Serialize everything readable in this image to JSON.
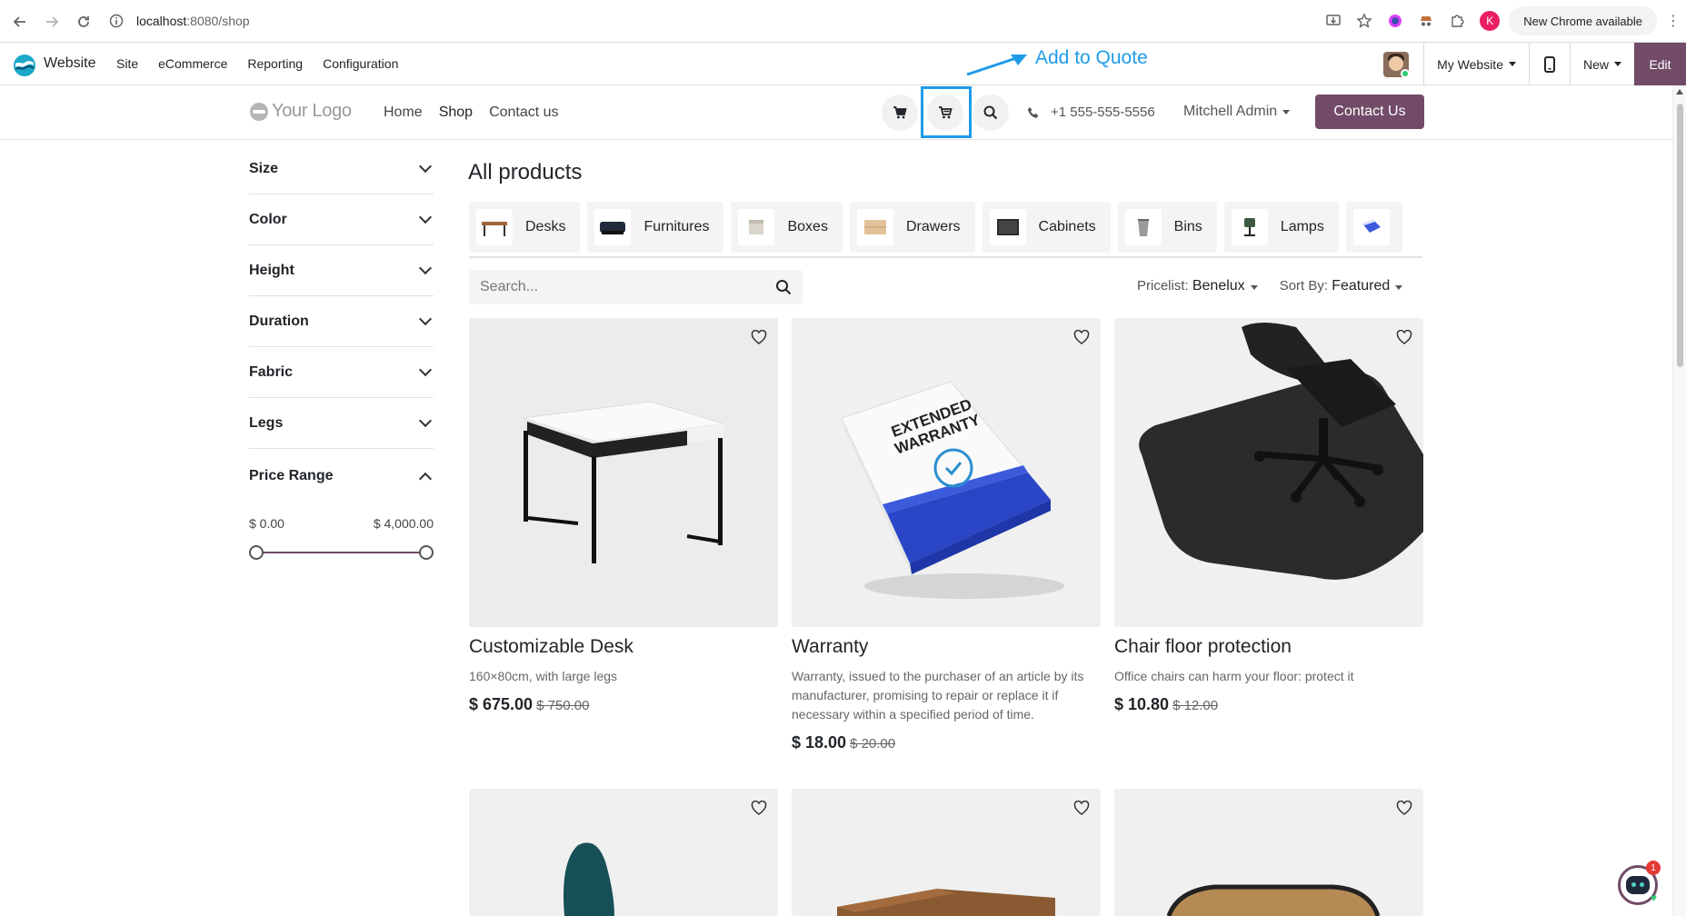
{
  "browser": {
    "url_host": "localhost",
    "url_path": ":8080/shop",
    "profile_initial": "K",
    "update_pill": "New Chrome available",
    "kebab": "⋮"
  },
  "odoo": {
    "app_name": "Website",
    "menu": [
      "Site",
      "eCommerce",
      "Reporting",
      "Configuration"
    ],
    "my_website": "My Website",
    "new_label": "New",
    "edit_label": "Edit"
  },
  "annotation": {
    "text": "Add to Quote",
    "color": "#1e9be8"
  },
  "site": {
    "logo": "Your Logo",
    "nav": [
      "Home",
      "Shop",
      "Contact us"
    ],
    "phone": "+1 555-555-5556",
    "user": "Mitchell Admin",
    "contact_btn": "Contact Us",
    "brand_color": "#714b67"
  },
  "filters": {
    "items": [
      "Size",
      "Color",
      "Height",
      "Duration",
      "Fabric",
      "Legs"
    ],
    "price_range": {
      "label": "Price Range",
      "min": "$ 0.00",
      "max": "$ 4,000.00"
    }
  },
  "main": {
    "title": "All products",
    "categories": [
      "Desks",
      "Furnitures",
      "Boxes",
      "Drawers",
      "Cabinets",
      "Bins",
      "Lamps"
    ],
    "search_placeholder": "Search...",
    "pricelist_label": "Pricelist:",
    "pricelist_value": "Benelux",
    "sort_label": "Sort By:",
    "sort_value": "Featured"
  },
  "products": [
    {
      "name": "Customizable Desk",
      "desc": "160×80cm, with large legs",
      "price": "$ 675.00",
      "old_price": "$ 750.00"
    },
    {
      "name": "Warranty",
      "desc": "Warranty, issued to the purchaser of an article by its manufacturer, promising to repair or replace it if necessary within a specified period of time.",
      "price": "$ 18.00",
      "old_price": "$ 20.00"
    },
    {
      "name": "Chair floor protection",
      "desc": "Office chairs can harm your floor: protect it",
      "price": "$ 10.80",
      "old_price": "$ 12.00"
    }
  ],
  "warranty_box": {
    "line1": "EXTENDED",
    "line2": "WARRANTY"
  },
  "chat": {
    "badge": "1"
  }
}
